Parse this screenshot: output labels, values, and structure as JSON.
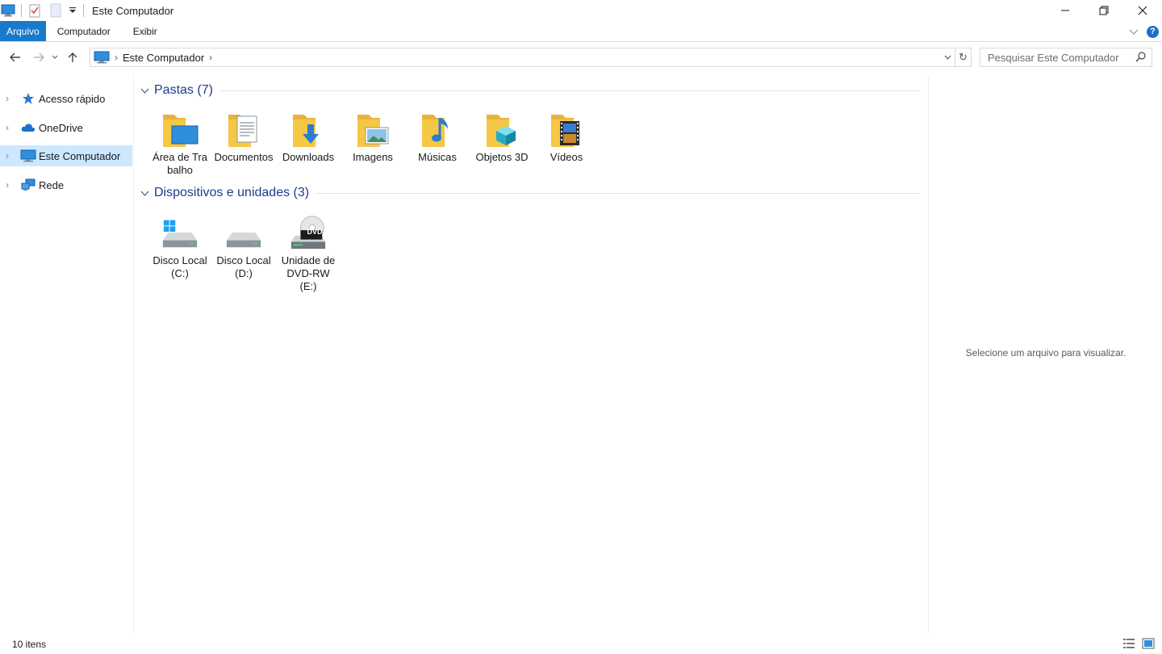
{
  "window": {
    "title": "Este Computador",
    "controls": {
      "minimize": "—",
      "restore": "❐",
      "close": "✕"
    }
  },
  "ribbon": {
    "tabs": [
      {
        "label": "Arquivo"
      },
      {
        "label": "Computador"
      },
      {
        "label": "Exibir"
      }
    ],
    "help_glyph": "?",
    "expand_glyph": "⌵"
  },
  "address": {
    "crumbs": [
      "Este Computador"
    ],
    "refresh_glyph": "↻"
  },
  "search": {
    "placeholder": "Pesquisar Este Computador"
  },
  "navpane": {
    "items": [
      {
        "label": "Acesso rápido",
        "icon": "star-icon",
        "selected": false
      },
      {
        "label": "OneDrive",
        "icon": "cloud-icon",
        "selected": false
      },
      {
        "label": "Este Computador",
        "icon": "computer-icon",
        "selected": true
      },
      {
        "label": "Rede",
        "icon": "network-icon",
        "selected": false
      }
    ]
  },
  "groups": {
    "folders": {
      "title": "Pastas (7)",
      "items": [
        {
          "label": "Área de Trabalho",
          "icon": "desktop-folder-icon"
        },
        {
          "label": "Documentos",
          "icon": "documents-folder-icon"
        },
        {
          "label": "Downloads",
          "icon": "downloads-folder-icon"
        },
        {
          "label": "Imagens",
          "icon": "pictures-folder-icon"
        },
        {
          "label": "Músicas",
          "icon": "music-folder-icon"
        },
        {
          "label": "Objetos 3D",
          "icon": "3d-objects-folder-icon"
        },
        {
          "label": "Vídeos",
          "icon": "videos-folder-icon"
        }
      ]
    },
    "devices": {
      "title": "Dispositivos e unidades (3)",
      "items": [
        {
          "label": "Disco Local (C:)",
          "icon": "windows-drive-icon"
        },
        {
          "label": "Disco Local (D:)",
          "icon": "drive-icon"
        },
        {
          "label": "Unidade de DVD-RW (E:)",
          "icon": "dvd-drive-icon",
          "badge": "DVD"
        }
      ]
    }
  },
  "preview": {
    "message": "Selecione um arquivo para visualizar."
  },
  "status": {
    "count": "10 itens"
  },
  "colors": {
    "accent": "#1979ca",
    "selection": "#cce8ff",
    "group_title": "#1e3c8c",
    "folder_yellow": "#f6c744"
  }
}
